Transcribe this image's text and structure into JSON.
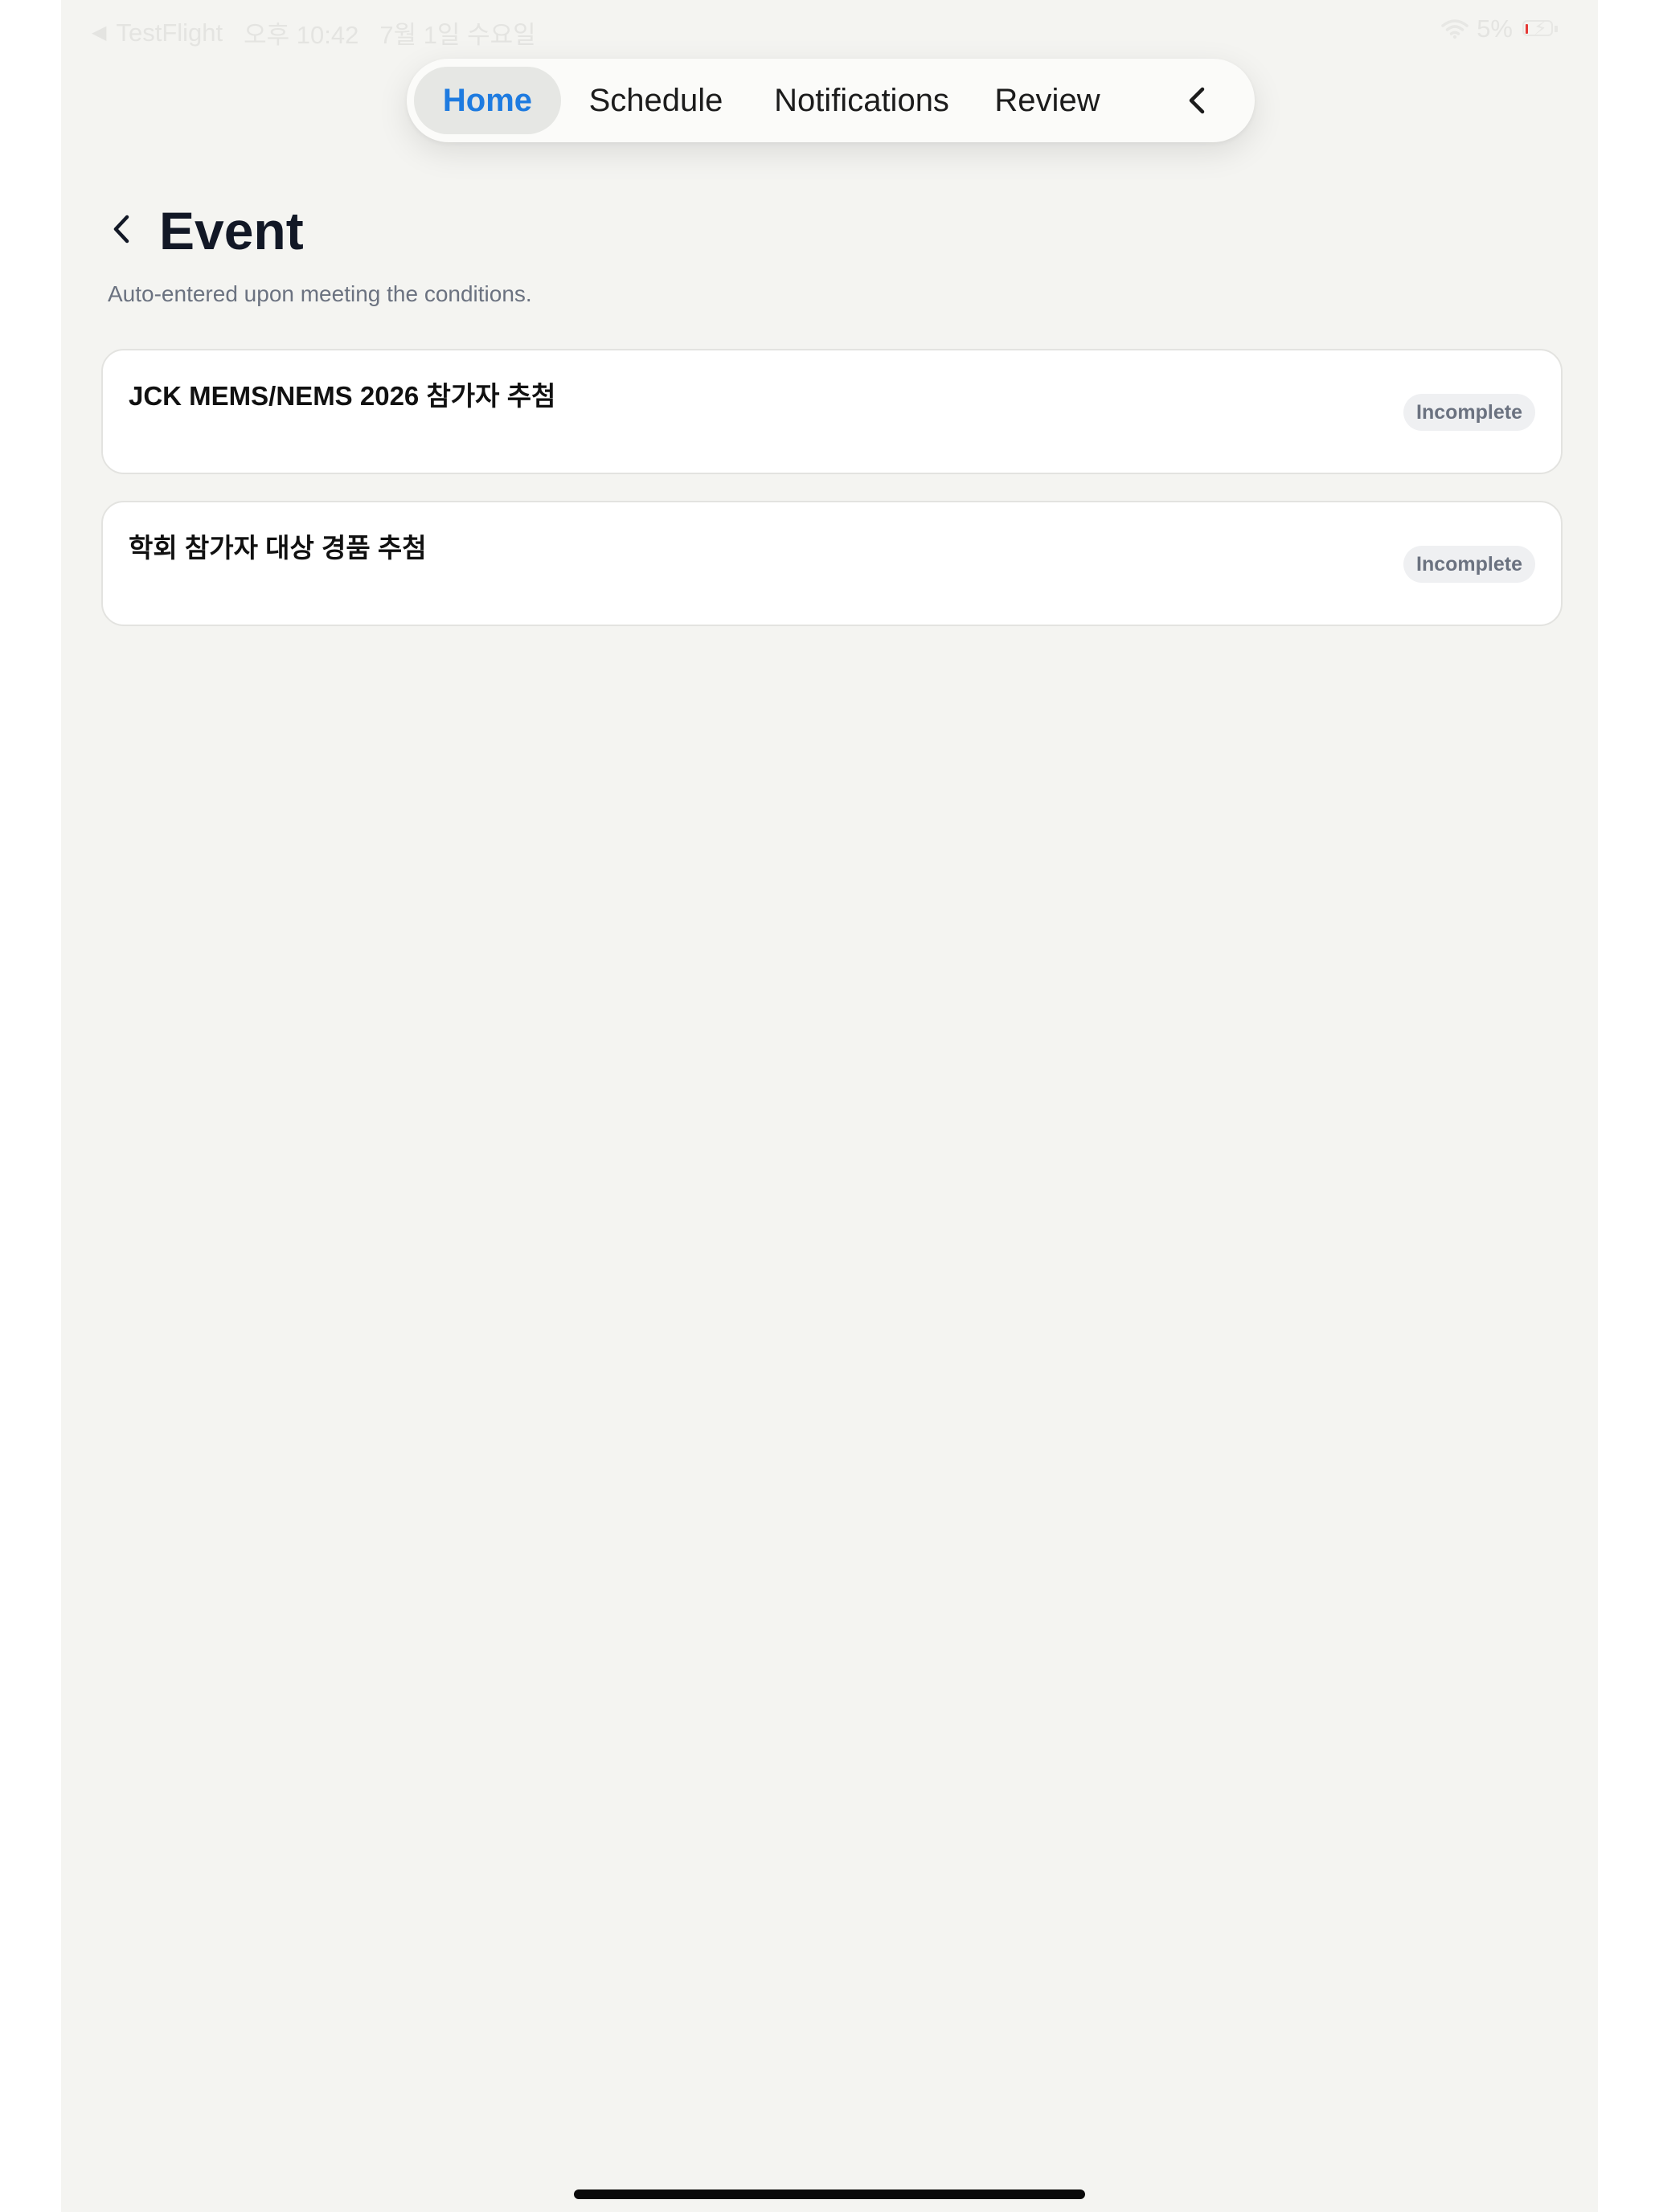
{
  "status_bar": {
    "back_app": "TestFlight",
    "time": "오후 10:42",
    "date": "7월 1일 수요일",
    "battery": "5%",
    "colors": {
      "battery_low": "#e53935"
    }
  },
  "tabs": [
    {
      "label": "Home",
      "selected": true
    },
    {
      "label": "Schedule",
      "selected": false
    },
    {
      "label": "Notifications",
      "selected": false
    },
    {
      "label": "Review",
      "selected": false
    }
  ],
  "tab_bar": {
    "collapse_icon": "chevron-left-icon"
  },
  "page": {
    "title": "Event",
    "subtitle": "Auto-entered upon meeting the conditions.",
    "back_icon": "chevron-left-icon"
  },
  "events": [
    {
      "title": "JCK MEMS/NEMS 2026 참가자 추첨",
      "status": "Incomplete"
    },
    {
      "title": "학회 참가자 대상 경품 추첨",
      "status": "Incomplete"
    }
  ],
  "colors": {
    "accent": "#1e7be0",
    "background": "#f4f4f1",
    "title_text": "#121826",
    "muted_text": "#6b7280"
  }
}
